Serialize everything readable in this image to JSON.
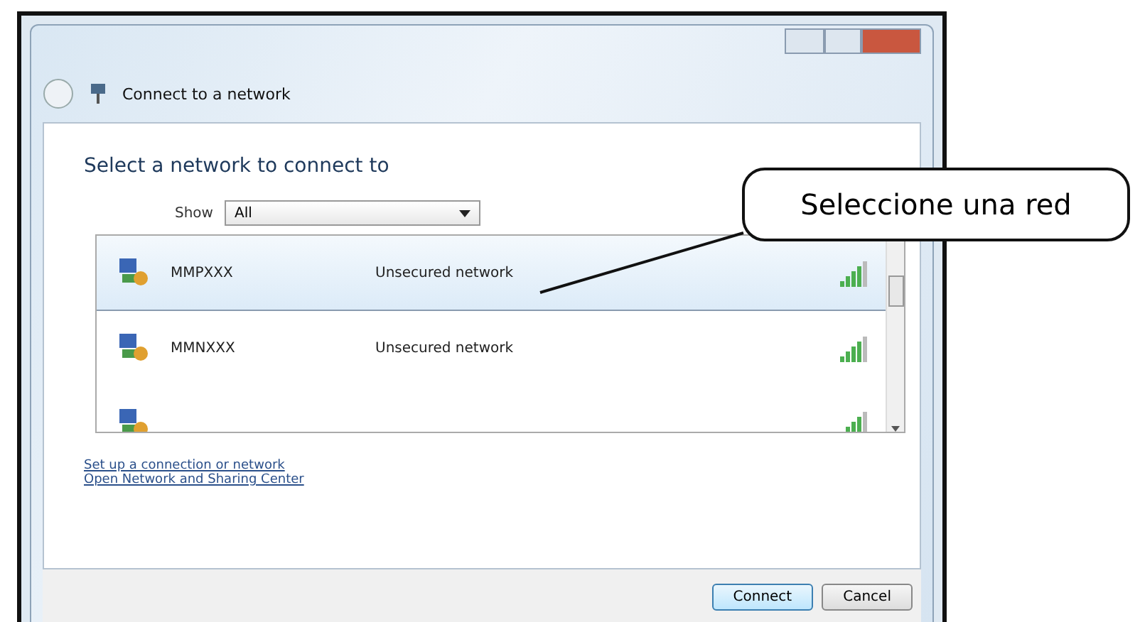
{
  "window": {
    "title": "Connect to a network"
  },
  "heading": "Select a network to connect to",
  "filter": {
    "label": "Show",
    "value": "All"
  },
  "networks": [
    {
      "name": "MMPXXX",
      "security": "Unsecured network",
      "selected": true
    },
    {
      "name": "MMNXXX",
      "security": "Unsecured network",
      "selected": false
    },
    {
      "selected": false
    }
  ],
  "links": [
    "Set up a connection or network",
    "Open Network and Sharing Center"
  ],
  "buttons": [
    {
      "label": "Connect",
      "default": true
    },
    {
      "label": "Cancel",
      "default": false
    }
  ],
  "callout": "Seleccione una red"
}
